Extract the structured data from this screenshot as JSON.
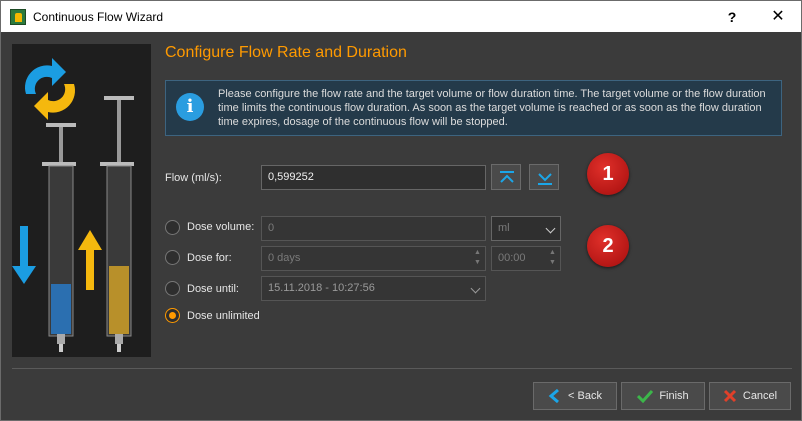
{
  "window": {
    "title": "Continuous Flow Wizard",
    "help_label": "?",
    "close_label": "✕"
  },
  "page": {
    "heading": "Configure Flow Rate and Duration",
    "info_text": "Please configure the flow rate and the target volume or flow duration time. The target volume or the flow duration time limits the continuous flow duration. As soon as the target volume is reached or as soon as the flow duration time expires, dosage of the continuous flow will be stopped."
  },
  "flow": {
    "label": "Flow (ml/s):",
    "value": "0,599252"
  },
  "badges": [
    "1",
    "2"
  ],
  "dose_options": {
    "volume": {
      "label": "Dose volume:",
      "value": "0",
      "unit": "ml"
    },
    "for": {
      "label": "Dose for:",
      "days": "0 days",
      "time": "00:00"
    },
    "until": {
      "label": "Dose until:",
      "datetime": "15.11.2018 - 10:27:56"
    },
    "unlimited": {
      "label": "Dose unlimited"
    },
    "selected": "unlimited"
  },
  "buttons": {
    "back": "< Back",
    "finish": "Finish",
    "cancel": "Cancel"
  },
  "colors": {
    "accent": "#ff9a00",
    "info_bg": "#243a4a",
    "badge": "#c0201b"
  }
}
